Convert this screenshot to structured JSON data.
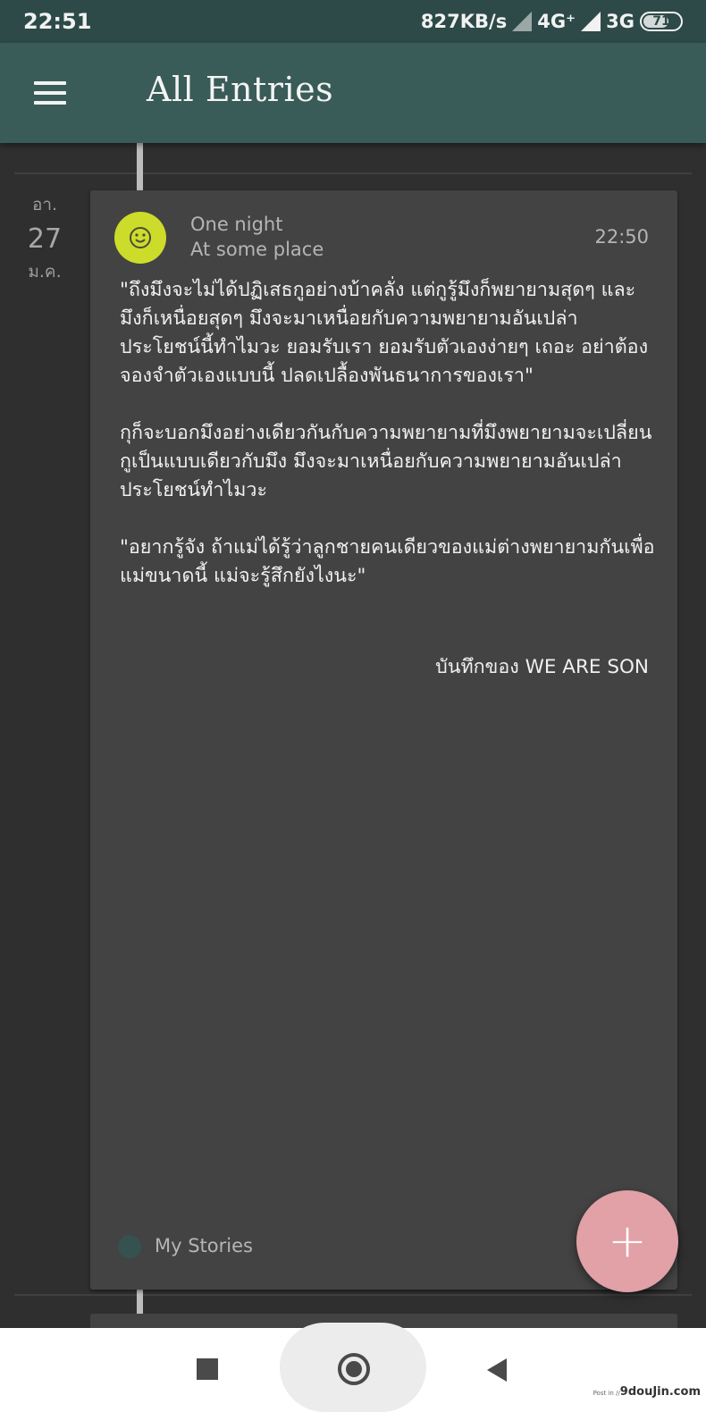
{
  "status_bar": {
    "time": "22:51",
    "network_speed": "827KB/s",
    "network_1": "4G⁺",
    "network_2": "3G",
    "battery": "71"
  },
  "app_bar": {
    "title": "All Entries"
  },
  "entry": {
    "date": {
      "day_of_week": "อา.",
      "day": "27",
      "month": "ม.ค."
    },
    "mood_icon": "smiley-icon",
    "mood_color": "#cddc2a",
    "title": "One night",
    "location": "At some place",
    "time": "22:50",
    "paragraphs": [
      "\"ถึงมึงจะไม่ได้ปฏิเสธกูอย่างบ้าคลั่ง แต่กูรู้มึงก็พยายามสุดๆ และมึงก็เหนื่อยสุดๆ มึงจะมาเหนื่อยกับความพยายามอันเปล่าประโยชน์นี้ทำไมวะ ยอมรับเรา ยอมรับตัวเองง่ายๆ เถอะ อย่าต้องจองจำตัวเองแบบนี้ ปลดเปลื้องพันธนาการของเรา\"",
      "กุก็จะบอกมึงอย่างเดียวกันกับความพยายามที่มึงพยายามจะเปลี่ยนกูเป็นแบบเดียวกับมึง มึงจะมาเหนื่อยกับความพยายามอันเปล่าประโยชน์ทำไมวะ",
      "\"อยากรู้จัง ถ้าแม่ได้รู้ว่าลูกชายคนเดียวของแม่ต่างพยายามกันเพื่อแม่ขนาดนี้ แม่จะรู้สึกยังไงนะ\""
    ],
    "signature": "บันทึกของ WE ARE SON",
    "journal": {
      "name": "My Stories",
      "color": "#355250"
    }
  },
  "fab": {
    "label": "+",
    "icon": "plus-icon"
  },
  "watermark": {
    "prefix": "Post in //",
    "text": "9douJin.com"
  },
  "colors": {
    "status_bar": "#2d4a48",
    "app_bar": "#3a5c59",
    "background": "#2f2f2f",
    "card": "#434343",
    "fab": "#e1a1a6"
  }
}
